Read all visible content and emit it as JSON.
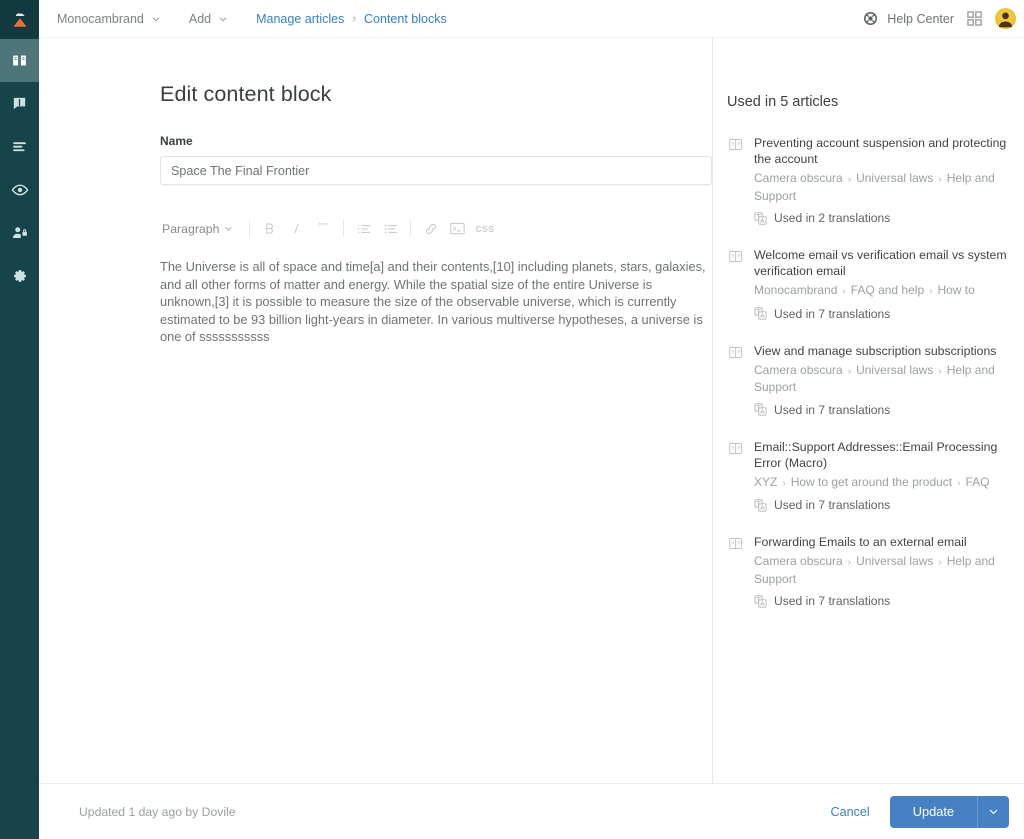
{
  "sidebar": {
    "logo_name": "brand-logo",
    "items": [
      {
        "name": "knowledge-base",
        "icon": "book-icon",
        "active": true
      },
      {
        "name": "announcements",
        "icon": "speech-bubble-alert-icon",
        "active": false
      },
      {
        "name": "lists",
        "icon": "list-lines-icon",
        "active": false
      },
      {
        "name": "preview",
        "icon": "eye-icon",
        "active": false
      },
      {
        "name": "user-permissions",
        "icon": "user-lock-icon",
        "active": false
      },
      {
        "name": "settings",
        "icon": "gear-icon",
        "active": false
      }
    ]
  },
  "header": {
    "brand_menu": "Monocambrand",
    "add_menu": "Add",
    "breadcrumb": {
      "parent": "Manage articles",
      "separator": "›",
      "current": "Content blocks"
    },
    "help_center": "Help Center",
    "apps_icon": "apps-grid-icon",
    "avatar_icon": "user-avatar"
  },
  "main": {
    "title": "Edit content block",
    "name_label": "Name",
    "name_value": "Space The Final Frontier",
    "name_placeholder": "Name",
    "toolbar": {
      "block_format": "Paragraph",
      "bold": "B",
      "italic": "I",
      "quote": "””",
      "ordered_list": "ordered-list-icon",
      "bullet_list": "bullet-list-icon",
      "link": "link-icon",
      "code": "code-block-icon",
      "css": "CSS"
    },
    "content": "The Universe is all of space and time[a] and their contents,[10] including planets, stars, galaxies, and all other forms of matter and energy. While the spatial size of the entire Universe is unknown,[3] it is possible to measure the size of the observable universe, which is currently estimated to be 93 billion light-years in diameter. In various multiverse hypotheses, a universe is one of sssssssssss"
  },
  "side_panel": {
    "title": "Used in 5 articles",
    "articles": [
      {
        "title": "Preventing account suspension and protecting the account",
        "path": [
          "Camera obscura",
          "Universal laws",
          "Help and Support"
        ],
        "translations": "Used in 2 translations"
      },
      {
        "title": "Welcome email vs verification email vs system verification email",
        "path": [
          "Monocambrand",
          "FAQ and help",
          "How to"
        ],
        "translations": "Used in 7 translations"
      },
      {
        "title": "View and manage subscription subscriptions",
        "path": [
          "Camera obscura",
          "Universal laws",
          "Help and Support"
        ],
        "translations": "Used in 7 translations"
      },
      {
        "title": "Email::Support Addresses::Email Processing Error (Macro)",
        "path": [
          "XYZ",
          "How to get around the product",
          "FAQ"
        ],
        "translations": "Used in 7 translations"
      },
      {
        "title": "Forwarding Emails to an external email",
        "path": [
          "Camera obscura",
          "Universal laws",
          "Help and Support"
        ],
        "translations": "Used in 7 translations"
      }
    ]
  },
  "footer": {
    "updated_note": "Updated 1 day ago by Dovile",
    "cancel_label": "Cancel",
    "update_label": "Update",
    "caret_icon": "chevron-down-icon"
  },
  "colors": {
    "sidebar_bg": "#17444a",
    "sidebar_active": "#4e767a",
    "logo_orange": "#e8703a",
    "link_blue": "#3a7fc1",
    "primary_button": "#4781c3",
    "avatar_gold": "#edc23b"
  }
}
